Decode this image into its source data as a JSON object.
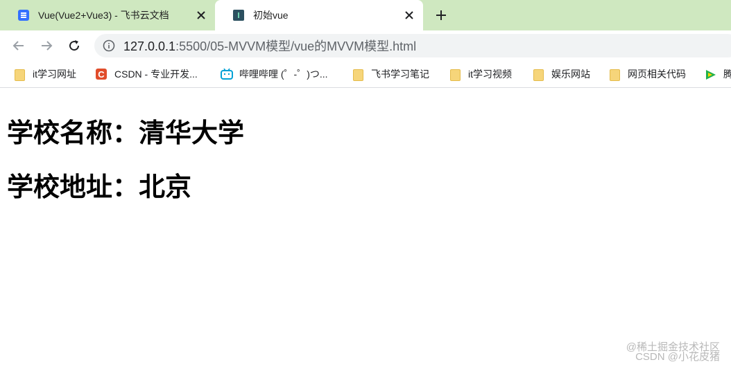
{
  "tabs": [
    {
      "title": "Vue(Vue2+Vue3) - 飞书云文档",
      "icon": "feishu-doc-icon",
      "active": false
    },
    {
      "title": "初始vue",
      "icon": "vscode-live-server-icon",
      "active": true
    }
  ],
  "toolbar": {
    "url_host": "127.0.0.1",
    "url_path": ":5500/05-MVVM模型/vue的MVVM模型.html"
  },
  "bookmarks": [
    {
      "label": "it学习网址",
      "icon": "folder-icon"
    },
    {
      "label": "CSDN - 专业开发...",
      "icon": "csdn-icon",
      "icon_text": "C"
    },
    {
      "label": "哔哩哔哩 (゜-゜)つ...",
      "icon": "bilibili-icon"
    },
    {
      "label": "飞书学习笔记",
      "icon": "folder-icon"
    },
    {
      "label": "it学习视频",
      "icon": "folder-icon"
    },
    {
      "label": "娱乐网站",
      "icon": "folder-icon"
    },
    {
      "label": "网页相关代码",
      "icon": "folder-icon"
    },
    {
      "label": "腾",
      "icon": "tencent-video-icon"
    }
  ],
  "page": {
    "school_name_line": "学校名称：清华大学",
    "school_address_line": "学校地址：北京"
  },
  "watermark": {
    "line1": "@稀土掘金技术社区",
    "line2": "CSDN @小花皮猪"
  },
  "colors": {
    "tabstrip_bg": "#cfe8c0",
    "omnibox_bg": "#f1f3f4",
    "folder": "#f6d57a",
    "csdn": "#e14d2b"
  }
}
